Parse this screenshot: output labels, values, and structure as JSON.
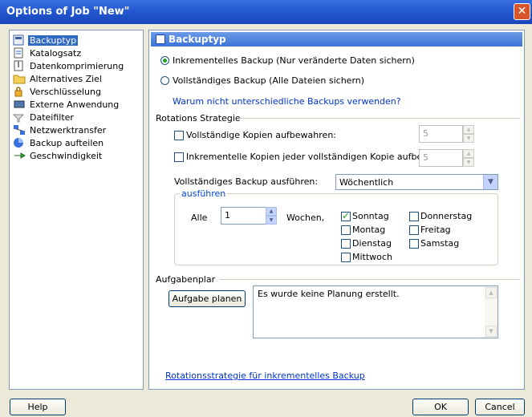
{
  "window": {
    "title": "Options of Job \"New\"",
    "close_glyph": "✕"
  },
  "tree": {
    "items": [
      {
        "label": "Backuptyp",
        "icon": "backup-type-icon",
        "selected": true
      },
      {
        "label": "Katalogsatz",
        "icon": "catalog-icon"
      },
      {
        "label": "Datenkomprimierung",
        "icon": "compression-icon"
      },
      {
        "label": "Alternatives Ziel",
        "icon": "folder-icon"
      },
      {
        "label": "Verschlüsselung",
        "icon": "lock-icon"
      },
      {
        "label": "Externe Anwendung",
        "icon": "external-app-icon"
      },
      {
        "label": "Dateifilter",
        "icon": "filter-icon"
      },
      {
        "label": "Netzwerktransfer",
        "icon": "network-icon"
      },
      {
        "label": "Backup aufteilen",
        "icon": "split-icon"
      },
      {
        "label": "Geschwindigkeit",
        "icon": "speed-icon"
      }
    ]
  },
  "panel": {
    "title": "Backuptyp",
    "radio_incremental": "Inkrementelles Backup (Nur veränderte Daten sichern)",
    "radio_full": "Vollständiges Backup (Alle Dateien sichern)",
    "why_link": "Warum nicht unterschiedliche Backups verwenden?",
    "rotation_title": "Rotations Strategie",
    "keep_full_label": "Vollständige Kopien aufbewahren:",
    "keep_full_value": "5",
    "keep_incr_label": "Inkrementelle Kopien jeder vollständigen Kopie aufbewahren:",
    "keep_incr_value": "5",
    "run_full_label": "Vollständiges Backup ausführen:",
    "run_full_select": "Wöchentlich",
    "execute_legend": "ausführen",
    "every_label": "Alle",
    "every_value": "1",
    "weeks_label": "Wochen,",
    "days": {
      "sunday": "Sonntag",
      "monday": "Montag",
      "tuesday": "Dienstag",
      "wednesday": "Mittwoch",
      "thursday": "Donnerstag",
      "friday": "Freitag",
      "saturday": "Samstag"
    },
    "scheduler_title": "Aufgabenplar",
    "schedule_button": "Aufgabe planen",
    "schedule_text": "Es wurde keine Planung erstellt.",
    "bottom_link": "Rotationsstrategie für inkrementelles Backup"
  },
  "footer": {
    "help": "Help",
    "ok": "OK",
    "cancel": "Cancel"
  },
  "colors": {
    "title_bar": "#2a5fd6",
    "link": "#0033cc",
    "check": "#21a121"
  }
}
